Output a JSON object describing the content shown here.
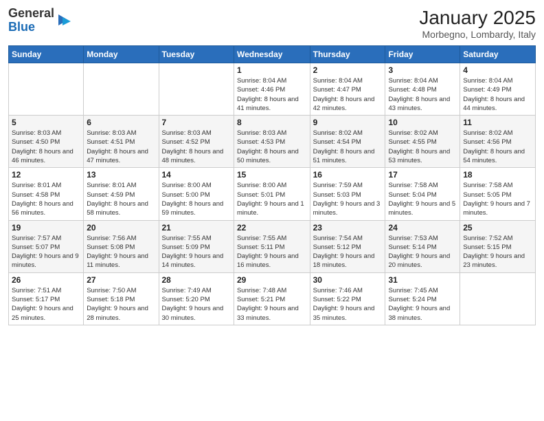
{
  "header": {
    "logo_general": "General",
    "logo_blue": "Blue",
    "month": "January 2025",
    "location": "Morbegno, Lombardy, Italy"
  },
  "days_of_week": [
    "Sunday",
    "Monday",
    "Tuesday",
    "Wednesday",
    "Thursday",
    "Friday",
    "Saturday"
  ],
  "weeks": [
    [
      {
        "day": "",
        "info": ""
      },
      {
        "day": "",
        "info": ""
      },
      {
        "day": "",
        "info": ""
      },
      {
        "day": "1",
        "info": "Sunrise: 8:04 AM\nSunset: 4:46 PM\nDaylight: 8 hours and 41 minutes."
      },
      {
        "day": "2",
        "info": "Sunrise: 8:04 AM\nSunset: 4:47 PM\nDaylight: 8 hours and 42 minutes."
      },
      {
        "day": "3",
        "info": "Sunrise: 8:04 AM\nSunset: 4:48 PM\nDaylight: 8 hours and 43 minutes."
      },
      {
        "day": "4",
        "info": "Sunrise: 8:04 AM\nSunset: 4:49 PM\nDaylight: 8 hours and 44 minutes."
      }
    ],
    [
      {
        "day": "5",
        "info": "Sunrise: 8:03 AM\nSunset: 4:50 PM\nDaylight: 8 hours and 46 minutes."
      },
      {
        "day": "6",
        "info": "Sunrise: 8:03 AM\nSunset: 4:51 PM\nDaylight: 8 hours and 47 minutes."
      },
      {
        "day": "7",
        "info": "Sunrise: 8:03 AM\nSunset: 4:52 PM\nDaylight: 8 hours and 48 minutes."
      },
      {
        "day": "8",
        "info": "Sunrise: 8:03 AM\nSunset: 4:53 PM\nDaylight: 8 hours and 50 minutes."
      },
      {
        "day": "9",
        "info": "Sunrise: 8:02 AM\nSunset: 4:54 PM\nDaylight: 8 hours and 51 minutes."
      },
      {
        "day": "10",
        "info": "Sunrise: 8:02 AM\nSunset: 4:55 PM\nDaylight: 8 hours and 53 minutes."
      },
      {
        "day": "11",
        "info": "Sunrise: 8:02 AM\nSunset: 4:56 PM\nDaylight: 8 hours and 54 minutes."
      }
    ],
    [
      {
        "day": "12",
        "info": "Sunrise: 8:01 AM\nSunset: 4:58 PM\nDaylight: 8 hours and 56 minutes."
      },
      {
        "day": "13",
        "info": "Sunrise: 8:01 AM\nSunset: 4:59 PM\nDaylight: 8 hours and 58 minutes."
      },
      {
        "day": "14",
        "info": "Sunrise: 8:00 AM\nSunset: 5:00 PM\nDaylight: 8 hours and 59 minutes."
      },
      {
        "day": "15",
        "info": "Sunrise: 8:00 AM\nSunset: 5:01 PM\nDaylight: 9 hours and 1 minute."
      },
      {
        "day": "16",
        "info": "Sunrise: 7:59 AM\nSunset: 5:03 PM\nDaylight: 9 hours and 3 minutes."
      },
      {
        "day": "17",
        "info": "Sunrise: 7:58 AM\nSunset: 5:04 PM\nDaylight: 9 hours and 5 minutes."
      },
      {
        "day": "18",
        "info": "Sunrise: 7:58 AM\nSunset: 5:05 PM\nDaylight: 9 hours and 7 minutes."
      }
    ],
    [
      {
        "day": "19",
        "info": "Sunrise: 7:57 AM\nSunset: 5:07 PM\nDaylight: 9 hours and 9 minutes."
      },
      {
        "day": "20",
        "info": "Sunrise: 7:56 AM\nSunset: 5:08 PM\nDaylight: 9 hours and 11 minutes."
      },
      {
        "day": "21",
        "info": "Sunrise: 7:55 AM\nSunset: 5:09 PM\nDaylight: 9 hours and 14 minutes."
      },
      {
        "day": "22",
        "info": "Sunrise: 7:55 AM\nSunset: 5:11 PM\nDaylight: 9 hours and 16 minutes."
      },
      {
        "day": "23",
        "info": "Sunrise: 7:54 AM\nSunset: 5:12 PM\nDaylight: 9 hours and 18 minutes."
      },
      {
        "day": "24",
        "info": "Sunrise: 7:53 AM\nSunset: 5:14 PM\nDaylight: 9 hours and 20 minutes."
      },
      {
        "day": "25",
        "info": "Sunrise: 7:52 AM\nSunset: 5:15 PM\nDaylight: 9 hours and 23 minutes."
      }
    ],
    [
      {
        "day": "26",
        "info": "Sunrise: 7:51 AM\nSunset: 5:17 PM\nDaylight: 9 hours and 25 minutes."
      },
      {
        "day": "27",
        "info": "Sunrise: 7:50 AM\nSunset: 5:18 PM\nDaylight: 9 hours and 28 minutes."
      },
      {
        "day": "28",
        "info": "Sunrise: 7:49 AM\nSunset: 5:20 PM\nDaylight: 9 hours and 30 minutes."
      },
      {
        "day": "29",
        "info": "Sunrise: 7:48 AM\nSunset: 5:21 PM\nDaylight: 9 hours and 33 minutes."
      },
      {
        "day": "30",
        "info": "Sunrise: 7:46 AM\nSunset: 5:22 PM\nDaylight: 9 hours and 35 minutes."
      },
      {
        "day": "31",
        "info": "Sunrise: 7:45 AM\nSunset: 5:24 PM\nDaylight: 9 hours and 38 minutes."
      },
      {
        "day": "",
        "info": ""
      }
    ]
  ]
}
